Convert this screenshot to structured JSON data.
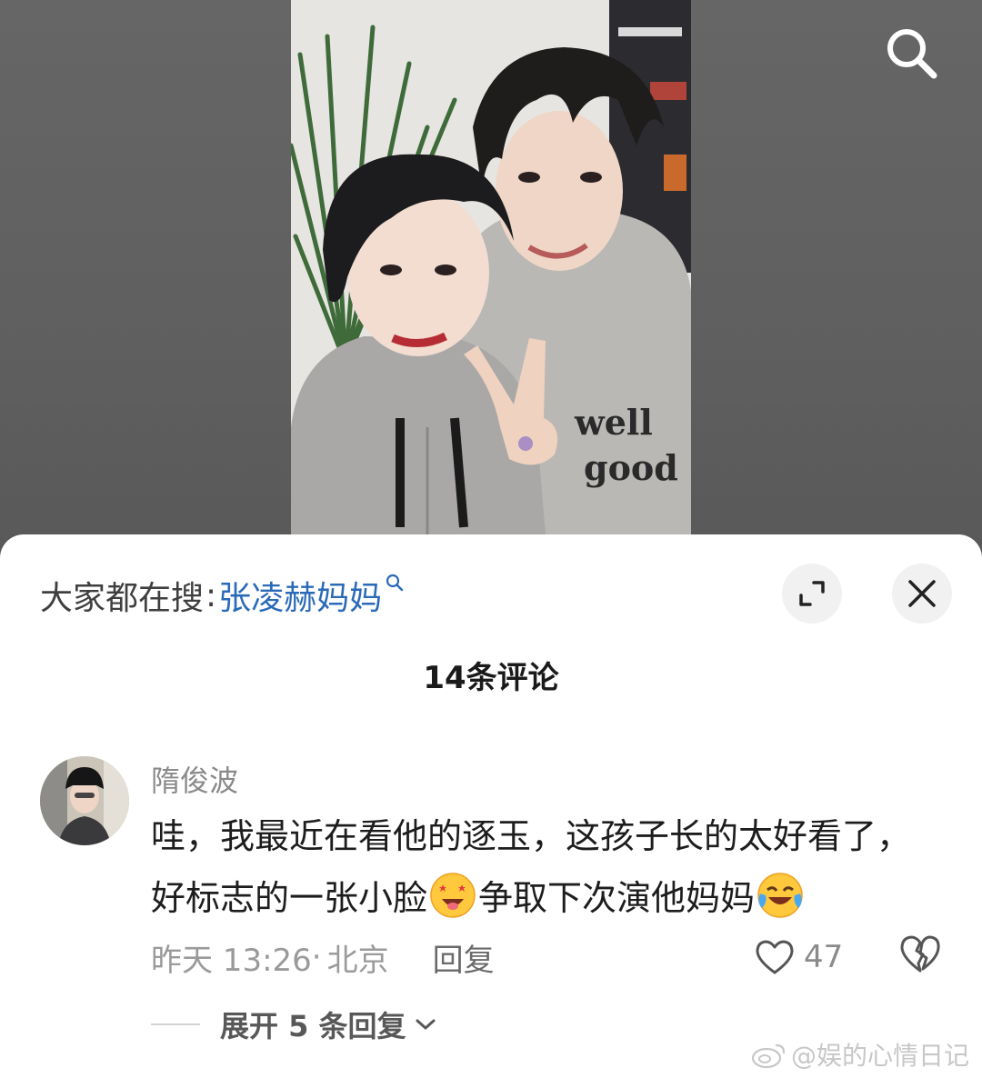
{
  "hot_search": {
    "prefix": "大家都在搜",
    "colon": ":",
    "keyword": "张凌赫妈妈"
  },
  "comments_header": {
    "count_label": "14条评论"
  },
  "comment": {
    "username": "隋俊波",
    "text_part1": "哇，我最近在看他的逐玉，这孩子长的太好看了，好标志的一张小脸",
    "text_part2": "争取下次演他妈妈",
    "emoji1": "star-struck-face",
    "emoji2": "laughing-tears-face",
    "timestamp": "昨天 13:26",
    "location_sep": "·",
    "location": "北京",
    "reply_label": "回复",
    "like_count": "47",
    "expand_replies_label": "展开 5 条回复"
  },
  "watermark": {
    "text": "@娱的心情日记"
  },
  "icons": {
    "search": "search-icon",
    "expand": "expand-icon",
    "close": "close-icon",
    "heart": "heart-icon",
    "broken_heart": "broken-heart-icon",
    "chevron": "chevron-down-icon",
    "weibo": "weibo-logo-icon"
  },
  "colors": {
    "keyword_link": "#2a6ab8",
    "sheet_bg": "#ffffff",
    "viewer_bg": "#5f5f5f"
  }
}
